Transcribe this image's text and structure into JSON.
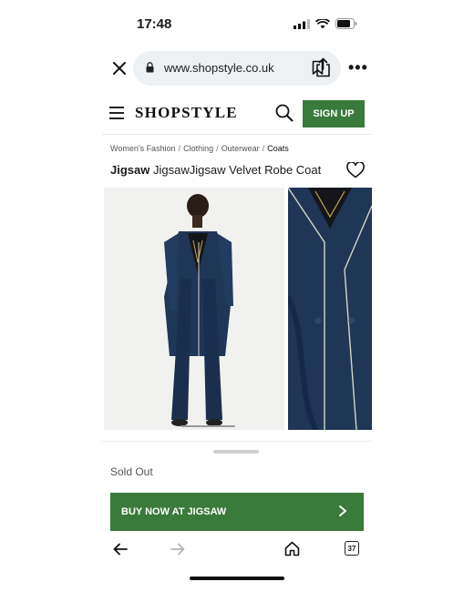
{
  "status_bar": {
    "time": "17:48"
  },
  "browser": {
    "url": "www.shopstyle.co.uk",
    "tabs_count": "37"
  },
  "site": {
    "logo": "SHOPSTYLE",
    "signup_label": "SIGN UP"
  },
  "breadcrumb": [
    "Women's Fashion",
    "Clothing",
    "Outerwear",
    "Coats"
  ],
  "product": {
    "brand": "Jigsaw",
    "name": "JigsawJigsaw Velvet Robe Coat",
    "availability": "Sold Out",
    "buy_label": "BUY NOW AT JIGSAW"
  },
  "colors": {
    "accent_green": "#3a7a3a",
    "velvet_navy": "#1f3656"
  }
}
